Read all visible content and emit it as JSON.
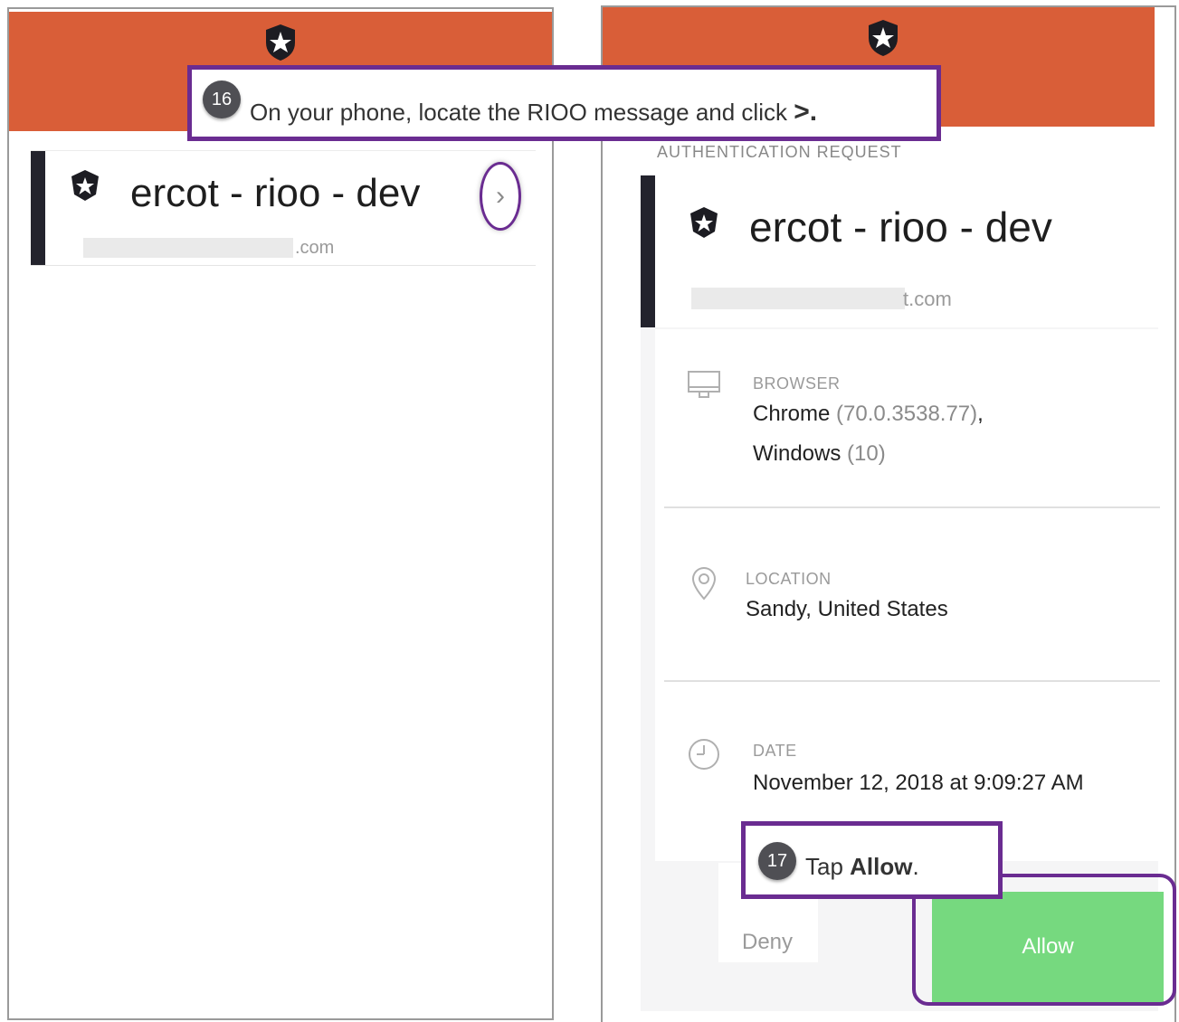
{
  "callout_16": {
    "number": "16",
    "text": "On your phone, locate the RIOO message and click",
    "symbol": ">."
  },
  "callout_17": {
    "number": "17",
    "prefix": "Tap ",
    "bold": "Allow",
    "suffix": "."
  },
  "left_phone": {
    "app_name": "ercot - rioo - dev",
    "domain_suffix": ".com",
    "chevron": "›"
  },
  "right_phone": {
    "section_label": "AUTHENTICATION REQUEST",
    "app_name": "ercot - rioo - dev",
    "domain_suffix": "t.com",
    "browser": {
      "label": "BROWSER",
      "name": "Chrome",
      "version": "(70.0.3538.77)",
      "comma": ",",
      "os": "Windows",
      "os_version": "(10)"
    },
    "location": {
      "label": "LOCATION",
      "value": "Sandy, United States"
    },
    "date": {
      "label": "DATE",
      "value": "November 12, 2018 at 9:09:27 AM"
    },
    "deny_label": "Deny",
    "allow_label": "Allow"
  },
  "colors": {
    "header": "#d95e38",
    "callout_border": "#6a2c91",
    "allow_button": "#76d97f",
    "card_bar": "#23232d"
  },
  "icons": [
    "shield-star-icon",
    "app-logo-icon",
    "chevron-right-icon",
    "monitor-icon",
    "location-pin-icon",
    "clock-icon"
  ]
}
